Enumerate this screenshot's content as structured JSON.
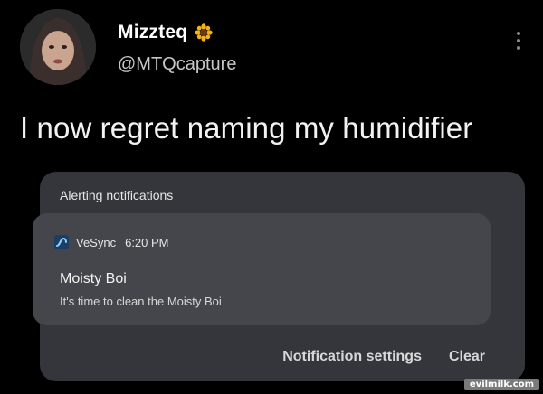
{
  "tweet": {
    "display_name": "Mizzteq",
    "handle": "@MTQcapture",
    "name_emoji_icon": "sunflower-icon",
    "text": "I now regret naming my humidifier"
  },
  "notification_panel": {
    "title": "Alerting notifications",
    "notification": {
      "app_name": "VeSync",
      "time": "6:20 PM",
      "title": "Moisty Boi",
      "body": "It's time to clean the Moisty Boi"
    },
    "actions": {
      "settings_label": "Notification settings",
      "clear_label": "Clear"
    }
  },
  "watermark": "evilmilk.com",
  "colors": {
    "background": "#000000",
    "panel": "#34363b",
    "card": "#44464c",
    "app_icon": "#3d8fd6"
  }
}
